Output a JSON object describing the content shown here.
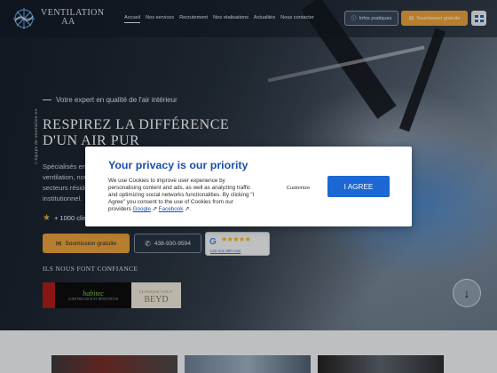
{
  "header": {
    "logo_text_line1": "VENTILATION",
    "logo_text_line2": "AA",
    "nav": [
      {
        "label": "Accueil"
      },
      {
        "label": "Nos services"
      },
      {
        "label": "Recrutement"
      },
      {
        "label": "Nos réalisations"
      },
      {
        "label": "Actualités"
      },
      {
        "label": "Nous contacter"
      }
    ],
    "info_button": "Infos pratiques",
    "quote_button": "Soumission gratuite"
  },
  "hero": {
    "tagline": "Votre expert en qualité de l'air intérieur",
    "title_line1": "RESPIREZ LA DIFFÉRENCE",
    "title_line2": "D'UN AIR PUR",
    "vertical_text": "L'équipe de Ventilation AA",
    "description": "Spécialisés en nettoyage de systèmes de ventilation, nous intervenons dans les secteurs résidentiel, commercial et institutionnel.",
    "stars_text": "+ 1000 clients",
    "quote_button": "Soumission gratuite",
    "phone": "438-930-9594",
    "google_link": "Lire nos 300 Avis",
    "google_stars": "★★★★★",
    "trust_heading": "ILS NOUS FONT CONFIANCE",
    "partners": [
      {
        "name": "habitec",
        "sub": "CONSTRUCTION ET RÉNOVATION"
      },
      {
        "name": "BEYD",
        "sub": "CLINIQUE GOUV"
      }
    ]
  },
  "cookie": {
    "title": "Your privacy is our priority",
    "body": "We use Cookies to improve user experience by personalising content and ads, as well as analyzing traffic and optimizing social networks functionalities. By clicking \"I Agree\" you consent to the use of Cookies from our providers",
    "link_google": "Google",
    "link_facebook": "Facebook",
    "customize": "Customize",
    "agree": "I AGREE"
  },
  "colors": {
    "accent": "#e9a23b",
    "cookie_blue": "#1b67d3",
    "title_blue": "#1b4fae"
  }
}
